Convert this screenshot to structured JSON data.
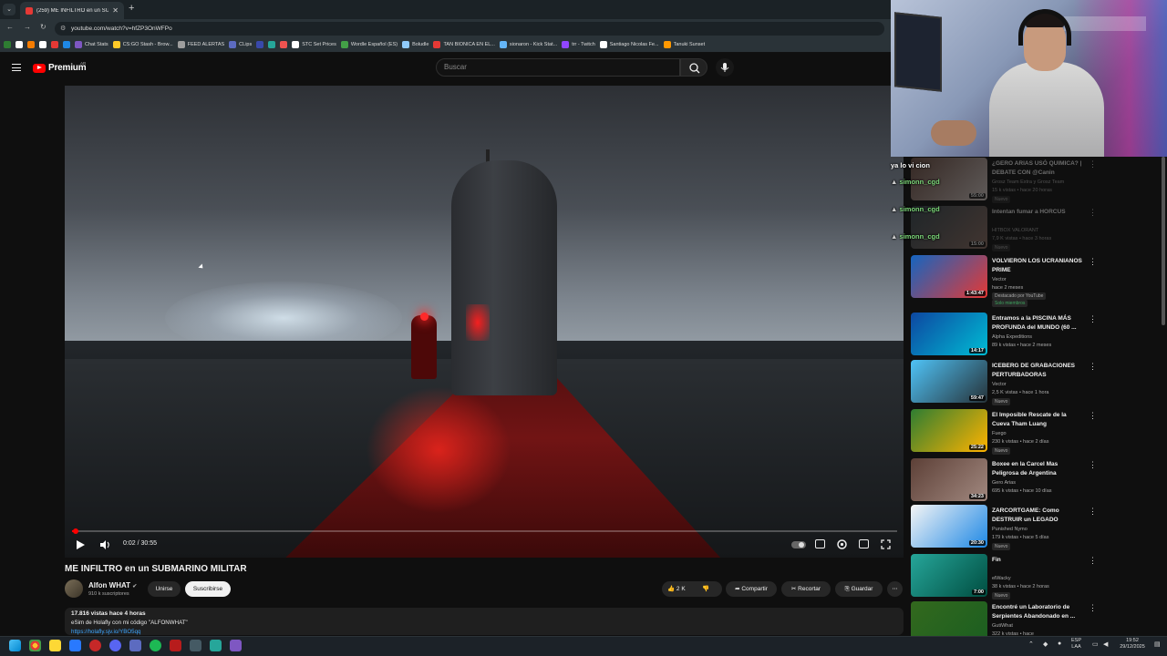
{
  "browser": {
    "tab_title": "(259) ME INFILTRO en un SUBM...",
    "tab_close": "✕",
    "new_tab": "+",
    "url": "youtube.com/watch?v=hfZP3OnWFPo",
    "bookmarks": [
      {
        "label": "",
        "color": "#2e7d32"
      },
      {
        "label": "",
        "color": "#ffffff"
      },
      {
        "label": "",
        "color": "#f57c00"
      },
      {
        "label": "",
        "color": "#ffffff"
      },
      {
        "label": "",
        "color": "#e53935"
      },
      {
        "label": "",
        "color": "#1e88e5"
      },
      {
        "label": "Chat Stats",
        "color": "#7e57c2"
      },
      {
        "label": "CS:GO Stash - Brow...",
        "color": "#ffca28"
      },
      {
        "label": "FEED ALERTAS",
        "color": "#9e9e9e"
      },
      {
        "label": "CLips",
        "color": "#5c6bc0"
      },
      {
        "label": "",
        "color": "#3949ab"
      },
      {
        "label": "",
        "color": "#26a69a"
      },
      {
        "label": "",
        "color": "#ef5350"
      },
      {
        "label": "STC Set Prices",
        "color": "#ffffff"
      },
      {
        "label": "Wordle Español (ES)",
        "color": "#43a047"
      },
      {
        "label": "Boludle",
        "color": "#90caf9"
      },
      {
        "label": "TAN BIONICA EN EL...",
        "color": "#e53935"
      },
      {
        "label": "sionaron - Kick Stat...",
        "color": "#64b5f6"
      },
      {
        "label": "trr - Twitch",
        "color": "#9146ff"
      },
      {
        "label": "Santiago Nicolas Fe...",
        "color": "#ffffff"
      },
      {
        "label": "Tanuki Sunset",
        "color": "#ff9800"
      }
    ]
  },
  "youtube": {
    "logo_word": "Premium",
    "logo_cc": "AR",
    "search_placeholder": "Buscar"
  },
  "player": {
    "time": "0:02 / 30:55",
    "progress": 0.001
  },
  "video": {
    "title": "ME INFILTRO en un SUBMARINO MILITAR",
    "channel": "Alfon WHAT",
    "subscribers": "910 k suscriptores",
    "join_label": "Unirse",
    "subscribe_label": "Suscribirse",
    "likes": "2 K",
    "share_label": "Compartir",
    "clip_label": "Recortar",
    "save_label": "Guardar",
    "desc_stats": "17.816 vistas  hace 4 horas",
    "desc_line": "eSim de Holafly con mi código \"ALFONWHAT\"",
    "desc_link": "https://holafly.sjv.io/YBO5qq"
  },
  "chat": [
    {
      "name": "",
      "text": "ya lo vi cion"
    },
    {
      "name": "simonn_cgd",
      "text": ""
    },
    {
      "name": "simonn_cgd",
      "text": ""
    },
    {
      "name": "simonn_cgd",
      "text": ""
    }
  ],
  "recommendations": [
    {
      "title": "¿GERO ARIAS USÓ QUIMICA? | DEBATE CON @Canin",
      "channel": "Grosz Team Extra y Grosz Team",
      "meta": "15 k vistas • hace 20 horas",
      "badge": "Nuevo",
      "duration": "55:00",
      "c1": "#6d4c41",
      "c2": "#d7ccc8",
      "dim": true
    },
    {
      "title": "Intentan fumar a HORCUS",
      "channel": "HITBOX VALORANT",
      "meta": "7,9 K vistas • hace 3 horas",
      "badge": "Nuevo",
      "duration": "15:00",
      "c1": "#37474f",
      "c2": "#8d6e63",
      "dim": true
    },
    {
      "title": "VOLVIERON LOS UCRANIANOS PRIME",
      "channel": "Vector",
      "meta": "hace 2 meses",
      "badge": "Destacado por YouTube",
      "extra": "Solo miembros",
      "duration": "1:43:47",
      "c1": "#1565c0",
      "c2": "#e53935",
      "dim": false
    },
    {
      "title": "Entramos a la PISCINA MÁS PROFUNDA del MUNDO (60 ...",
      "channel": "Alpha Expeditions",
      "meta": "89 k vistas • hace 2 meses",
      "badge": "",
      "duration": "14:17",
      "c1": "#0d47a1",
      "c2": "#00bcd4",
      "dim": false
    },
    {
      "title": "ICEBERG DE GRABACIONES PERTURBADORAS",
      "channel": "Vector",
      "meta": "2,5 K vistas • hace 1 hora",
      "badge": "Nuevo",
      "duration": "59:47",
      "c1": "#4fc3f7",
      "c2": "#263238",
      "dim": false
    },
    {
      "title": "El Imposible Rescate de la Cueva Tham Luang",
      "channel": "Fuego",
      "meta": "230 k vistas • hace 2 días",
      "badge": "Nuevo",
      "duration": "25:22",
      "c1": "#2e7d32",
      "c2": "#ffb300",
      "dim": false
    },
    {
      "title": "Boxee en la Carcel Mas Peligrosa de Argentina",
      "channel": "Gero Arias",
      "meta": "695 k vistas • hace 10 días",
      "badge": "",
      "duration": "34:23",
      "c1": "#5d4037",
      "c2": "#a1887f",
      "dim": false
    },
    {
      "title": "ZARCORTGAME: Como DESTRUIR un LEGADO",
      "channel": "Punished Nymo",
      "meta": "179 k vistas • hace 5 días",
      "badge": "Nuevo",
      "duration": "20:30",
      "c1": "#f5f5f5",
      "c2": "#1e88e5",
      "dim": false
    },
    {
      "title": "Fin",
      "channel": "elWacky",
      "meta": "38 k vistas • hace 2 horas",
      "badge": "Nuevo",
      "duration": "7:00",
      "c1": "#26a69a",
      "c2": "#004d40",
      "dim": false
    },
    {
      "title": "Encontré un Laboratorio de Serpientes Abandonado en ...",
      "channel": "GutiWhat",
      "meta": "322 k vistas • hace",
      "badge": "",
      "duration": "",
      "c1": "#33691e",
      "c2": "#1b5e20",
      "dim": false
    }
  ],
  "taskbar": {
    "lang": "ESP",
    "layout": "LAA",
    "time": "19:52",
    "date": "29/12/2025"
  }
}
